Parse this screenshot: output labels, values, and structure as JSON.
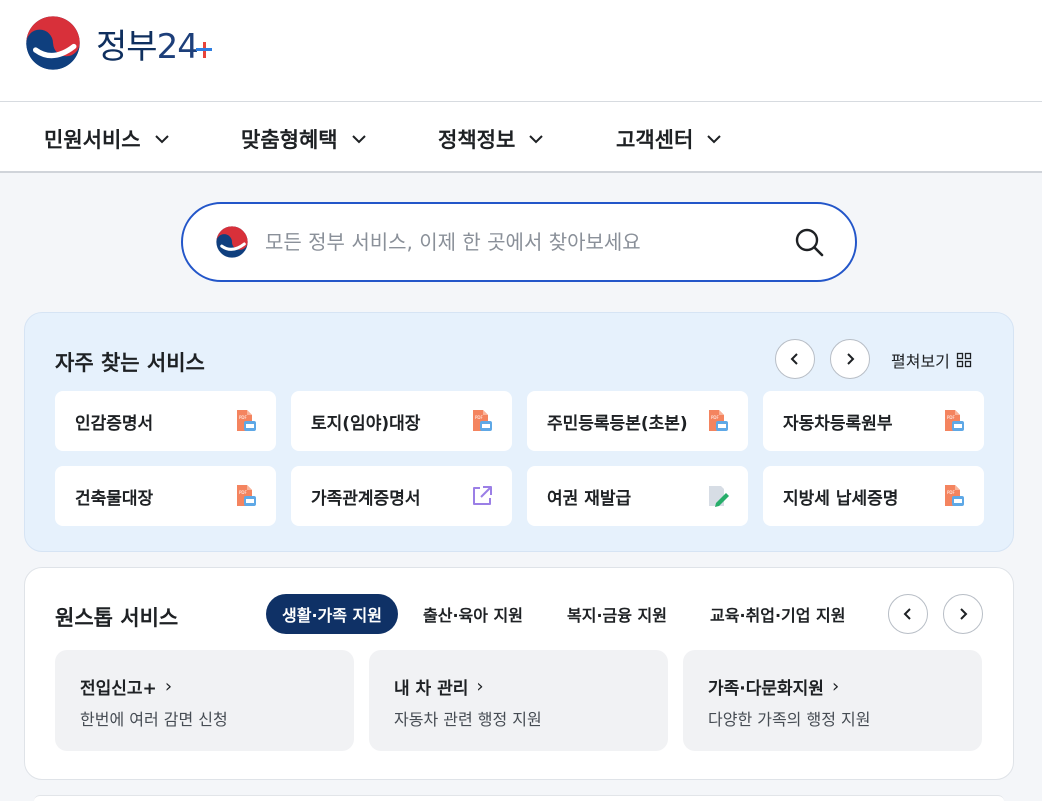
{
  "header": {
    "logo_text": "정부",
    "logo_number": "24"
  },
  "gnb": [
    {
      "label": "민원서비스"
    },
    {
      "label": "맞춤형혜택"
    },
    {
      "label": "정책정보"
    },
    {
      "label": "고객센터"
    }
  ],
  "search": {
    "placeholder": "모든 정부 서비스, 이제 한 곳에서 찾아보세요"
  },
  "frequent": {
    "title": "자주 찾는 서비스",
    "expand_label": "펼쳐보기",
    "items": [
      {
        "label": "인감증명서",
        "icon": "pdf-doc-icon"
      },
      {
        "label": "토지(임야)대장",
        "icon": "pdf-doc-icon"
      },
      {
        "label": "주민등록등본(초본)",
        "icon": "pdf-doc-icon"
      },
      {
        "label": "자동차등록원부",
        "icon": "pdf-doc-icon"
      },
      {
        "label": "건축물대장",
        "icon": "pdf-doc-icon"
      },
      {
        "label": "가족관계증명서",
        "icon": "external-link-icon"
      },
      {
        "label": "여권 재발급",
        "icon": "edit-doc-icon"
      },
      {
        "label": "지방세 납세증명",
        "icon": "pdf-doc-icon"
      }
    ]
  },
  "onestop": {
    "title": "원스톱 서비스",
    "tabs": [
      {
        "label": "생활·가족 지원",
        "active": true
      },
      {
        "label": "출산·육아 지원",
        "active": false
      },
      {
        "label": "복지·금융 지원",
        "active": false
      },
      {
        "label": "교육·취업·기업 지원",
        "active": false
      }
    ],
    "cards": [
      {
        "title": "전입신고+",
        "desc": "한번에 여러 감면 신청"
      },
      {
        "title": "내 차 관리",
        "desc": "자동차 관련 행정 지원"
      },
      {
        "title": "가족·다문화지원",
        "desc": "다양한 가족의 행정 지원"
      }
    ]
  },
  "colors": {
    "accent": "#2356c9",
    "active_tab": "#0f3166",
    "panel_bg": "#e6f1fc"
  }
}
